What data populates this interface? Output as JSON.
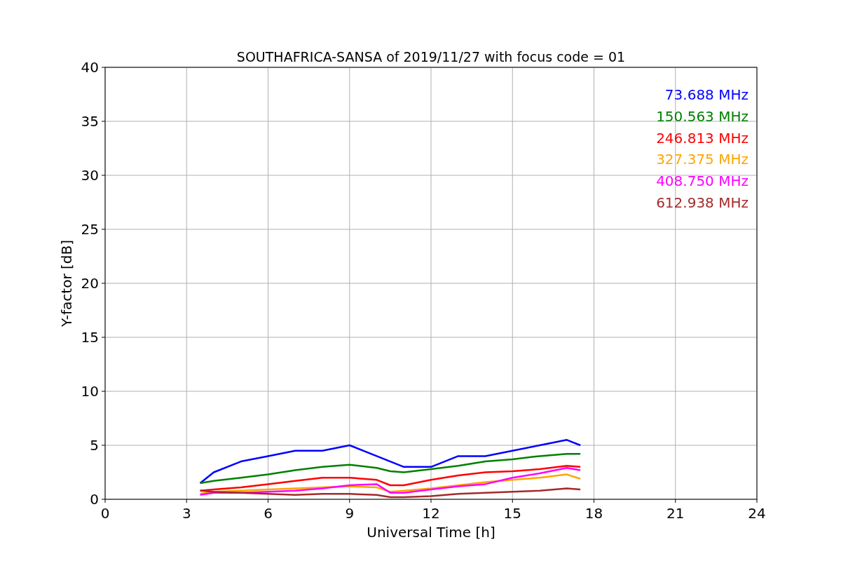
{
  "chart_data": {
    "type": "line",
    "title": "SOUTHAFRICA-SANSA of 2019/11/27 with focus code = 01",
    "xlabel": "Universal Time [h]",
    "ylabel": "Y-factor [dB]",
    "x": [
      3.5,
      4,
      5,
      6,
      7,
      8,
      9,
      10,
      10.5,
      11,
      12,
      13,
      14,
      15,
      16,
      17,
      17.5
    ],
    "series": [
      {
        "name": "73.688 MHz",
        "color": "#0000ff",
        "values": [
          1.5,
          2.5,
          3.5,
          4,
          4.5,
          4.5,
          5,
          4,
          3.5,
          3,
          3,
          4,
          4,
          4.5,
          5,
          5.5,
          5
        ]
      },
      {
        "name": "150.563 MHz",
        "color": "#008000",
        "values": [
          1.5,
          1.7,
          2,
          2.3,
          2.7,
          3,
          3.2,
          2.9,
          2.6,
          2.5,
          2.8,
          3.1,
          3.5,
          3.7,
          4,
          4.2,
          4.2
        ]
      },
      {
        "name": "246.813 MHz",
        "color": "#ff0000",
        "values": [
          0.8,
          0.9,
          1.1,
          1.4,
          1.7,
          2,
          2,
          1.8,
          1.3,
          1.3,
          1.8,
          2.2,
          2.5,
          2.6,
          2.8,
          3.1,
          3
        ]
      },
      {
        "name": "327.375 MHz",
        "color": "#ffa500",
        "values": [
          0.5,
          0.7,
          0.8,
          0.9,
          1,
          1.1,
          1.2,
          1.1,
          0.7,
          0.8,
          1,
          1.3,
          1.6,
          1.8,
          2,
          2.3,
          1.9
        ]
      },
      {
        "name": "408.750 MHz",
        "color": "#ff00ff",
        "values": [
          0.4,
          0.6,
          0.6,
          0.7,
          0.8,
          1,
          1.3,
          1.4,
          0.6,
          0.6,
          0.9,
          1.2,
          1.4,
          2,
          2.4,
          2.9,
          2.7
        ]
      },
      {
        "name": "612.938 MHz",
        "color": "#a52a2a",
        "values": [
          0.8,
          0.7,
          0.6,
          0.5,
          0.4,
          0.5,
          0.5,
          0.4,
          0.2,
          0.2,
          0.3,
          0.5,
          0.6,
          0.7,
          0.8,
          1,
          0.9
        ]
      }
    ],
    "xlim": [
      0,
      24
    ],
    "ylim": [
      0,
      40
    ],
    "xticks": [
      0,
      3,
      6,
      9,
      12,
      15,
      18,
      21,
      24
    ],
    "yticks": [
      0,
      5,
      10,
      15,
      20,
      25,
      30,
      35,
      40
    ],
    "grid": true
  }
}
